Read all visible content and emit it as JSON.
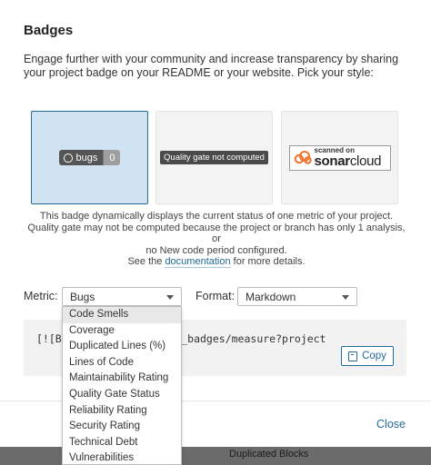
{
  "modal": {
    "title": "Badges",
    "intro": "Engage further with your community and increase transparency by sharing your project badge on your README or your website. Pick your style:",
    "badges": {
      "bugs": {
        "label": "bugs",
        "value": "0"
      },
      "quality_gate": {
        "label": "Quality gate not computed"
      },
      "scanned": {
        "top": "scanned on",
        "bottom_bold": "sonar",
        "bottom_rest": "cloud"
      }
    },
    "description": {
      "line1": "This badge dynamically displays the current status of one metric of your project.",
      "line2": "Quality gate may not be computed because the project or branch has only 1 analysis, or",
      "line3": "no New code period configured.",
      "see_prefix": "See the ",
      "see_link": "documentation",
      "see_suffix": " for more details."
    },
    "metric": {
      "label": "Metric:",
      "selected": "Bugs"
    },
    "format": {
      "label": "Format:",
      "selected": "Markdown"
    },
    "code": {
      "text": "[![Bu                    ud.io/api/project_badges/measure?project",
      "copy_label": "Copy"
    },
    "footer": {
      "close_label": "Close"
    },
    "backdrop_text": "Duplicated Blocks",
    "dropdown_items": [
      "Code Smells",
      "Coverage",
      "Duplicated Lines (%)",
      "Lines of Code",
      "Maintainability Rating",
      "Quality Gate Status",
      "Reliability Rating",
      "Security Rating",
      "Technical Debt",
      "Vulnerabilities"
    ]
  },
  "colors": {
    "accent": "#236a97",
    "selected_card": "#cfe3f2"
  }
}
